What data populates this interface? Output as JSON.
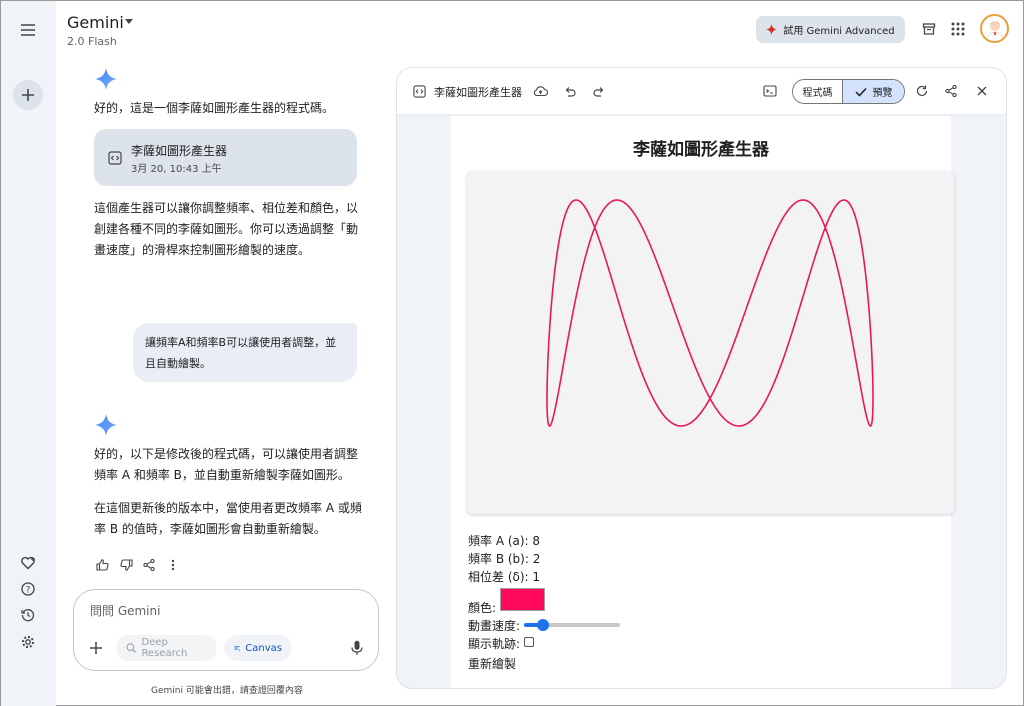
{
  "header": {
    "app_title": "Gemini",
    "model": "2.0 Flash",
    "advanced_button": "試用 Gemini Advanced",
    "icons": [
      "menu-icon",
      "new-chat-icon",
      "keep-icon",
      "apps-grid-icon",
      "avatar"
    ]
  },
  "chat": {
    "reply1_intro": "好的，這是一個李薩如圖形產生器的程式碼。",
    "artifact": {
      "title": "李薩如圖形產生器",
      "timestamp": "3月 20, 10:43 上午"
    },
    "reply1_body": "這個產生器可以讓你調整頻率、相位差和顏色，以創建各種不同的李薩如圖形。你可以透過調整「動畫速度」的滑桿來控制圖形繪製的速度。",
    "user_message": "讓頻率A和頻率B可以讓使用者調整，並且自動繪製。",
    "reply2_p1": "好的，以下是修改後的程式碼，可以讓使用者調整頻率 A 和頻率 B，並自動重新繪製李薩如圖形。",
    "reply2_p2": "在這個更新後的版本中，當使用者更改頻率 A 或頻率 B 的值時，李薩如圖形會自動重新繪製。"
  },
  "input": {
    "placeholder": "問問 Gemini",
    "deep_research": "Deep Research",
    "canvas": "Canvas",
    "disclaimer": "Gemini 可能會出錯，請查證回覆內容"
  },
  "panel": {
    "title": "李薩如圖形產生器",
    "code_tab": "程式碼",
    "preview_tab": "預覽"
  },
  "preview": {
    "heading": "李薩如圖形產生器",
    "freq_a": "頻率 A (a): 8",
    "freq_b": "頻率 B (b): 2",
    "phase": "相位差 (δ): 1",
    "color_label": "顏色:",
    "color_value": "#ff0a5a",
    "speed_label": "動畫速度:",
    "speed_level": 0.2,
    "trail_label": "顯示軌跡:",
    "redraw": "重新繪製",
    "curve_color": "#e8185a",
    "lissajous": {
      "a": 8,
      "b": 2,
      "delta": 1
    }
  }
}
